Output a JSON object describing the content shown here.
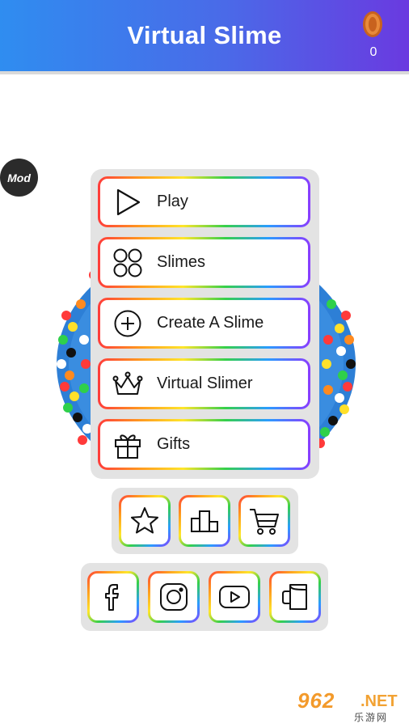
{
  "header": {
    "title": "Virtual Slime",
    "coin_count": "0"
  },
  "mod_badge": "Mod",
  "menu": [
    {
      "label": "Play",
      "icon": "play-icon"
    },
    {
      "label": "Slimes",
      "icon": "slimes-icon"
    },
    {
      "label": "Create A Slime",
      "icon": "plus-circle-icon"
    },
    {
      "label": "Virtual Slimer",
      "icon": "crown-icon"
    },
    {
      "label": "Gifts",
      "icon": "gift-icon"
    }
  ],
  "toolbar_icons": [
    "star-icon",
    "leaderboard-icon",
    "cart-icon"
  ],
  "social_icons": [
    "facebook-icon",
    "instagram-icon",
    "youtube-icon",
    "cup-icon"
  ],
  "watermark": {
    "main": "962",
    "suffix": ".NET",
    "sub": "乐游网"
  },
  "colors": {
    "header_start": "#2f8df0",
    "header_end": "#6a3ae0",
    "panel": "#e3e3e3",
    "slime": "#2d7fd6"
  }
}
